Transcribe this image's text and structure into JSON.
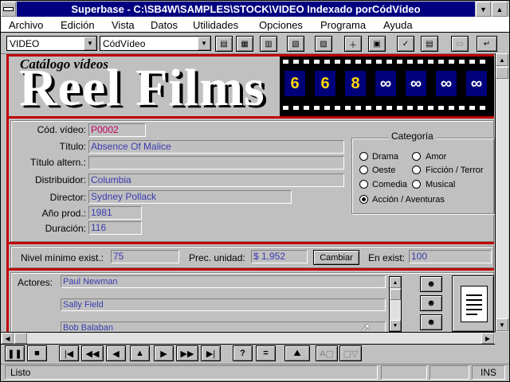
{
  "window": {
    "title": "Superbase - C:\\SB4W\\SAMPLES\\STOCK\\VIDEO Indexado porCódVídeo"
  },
  "menu": [
    "Archivo",
    "Edición",
    "Vista",
    "Datos",
    "Utilidades",
    "Opciones",
    "Programa",
    "Ayuda"
  ],
  "toolbar": {
    "file_select": "VIDEO",
    "index_select": "CódVídeo"
  },
  "banner": {
    "subtitle": "Catálogo vídeos",
    "title": "Reel Films"
  },
  "form": {
    "codigo_label": "Cód. vídeo:",
    "codigo_value": "P0002",
    "titulo_label": "Título:",
    "titulo_value": "Absence Of Malice",
    "titulo_alt_label": "Título altern.:",
    "titulo_alt_value": "",
    "distribuidor_label": "Distribuidor:",
    "distribuidor_value": "Columbia",
    "director_label": "Director:",
    "director_value": "Sydney Pollack",
    "anio_label": "Año prod.:",
    "anio_value": "1981",
    "duracion_label": "Duración:",
    "duracion_value": "116"
  },
  "categoria": {
    "legend": "Categoría",
    "options": [
      {
        "label": "Drama",
        "selected": false
      },
      {
        "label": "Amor",
        "selected": false
      },
      {
        "label": "Oeste",
        "selected": false
      },
      {
        "label": "Ficción / Terror",
        "selected": false
      },
      {
        "label": "Comedia",
        "selected": false
      },
      {
        "label": "Musical",
        "selected": false
      },
      {
        "label": "Acción / Aventuras",
        "selected": true
      }
    ]
  },
  "stock": {
    "nivel_label": "Nivel mínimo exist.:",
    "nivel_value": "75",
    "precio_label": "Prec. unidad:",
    "precio_value": "$ 1,952",
    "cambiar_label": "Cambiar",
    "existencia_label": "En exist:",
    "existencia_value": "100"
  },
  "actores": {
    "label": "Actores:",
    "list": [
      "Paul Newman",
      "Sally Field",
      "Bob Balaban"
    ]
  },
  "status": {
    "text": "Listo",
    "mode": "INS"
  },
  "colors": {
    "titlebar": "#000080",
    "accent_red": "#c00000",
    "field_text": "#3a3ab0",
    "film_blue": "#00007a"
  }
}
